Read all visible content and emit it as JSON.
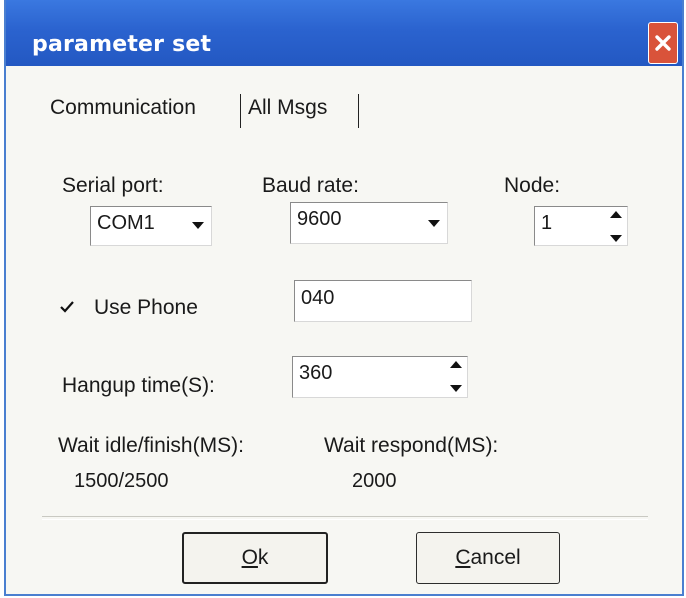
{
  "window": {
    "title": "parameter set"
  },
  "tabs": [
    "Communication",
    "All Msgs"
  ],
  "serial_port": {
    "label": "Serial port:",
    "value": "COM1"
  },
  "baud_rate": {
    "label": "Baud rate:",
    "value": "9600"
  },
  "node": {
    "label": "Node:",
    "value": "1"
  },
  "use_phone": {
    "label": "Use Phone",
    "checked": true,
    "value": "040"
  },
  "hangup": {
    "label": "Hangup time(S):",
    "value": "360"
  },
  "wait_idle": {
    "label": "Wait idle/finish(MS):",
    "value": "1500/2500"
  },
  "wait_respond": {
    "label": "Wait respond(MS):",
    "value": "2000"
  },
  "buttons": {
    "ok": {
      "mnemonic": "O",
      "rest": "k"
    },
    "cancel": {
      "mnemonic": "C",
      "rest": "ancel"
    }
  },
  "icons": {
    "close": "close-icon",
    "dropdown": "chevron-down-icon",
    "spin": "spin-arrows-icon",
    "check": "checkmark-icon"
  },
  "colors": {
    "titlebar": "#2b63cf",
    "close": "#d9533a",
    "dialog_bg": "#f7f7f3"
  }
}
